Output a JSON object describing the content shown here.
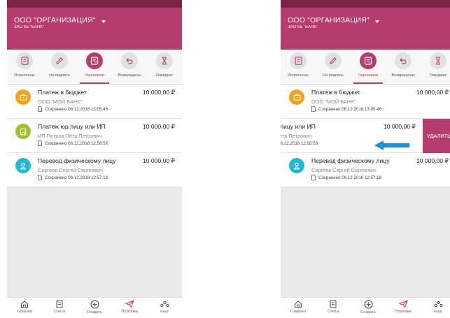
{
  "org": {
    "name": "ООО \"ОРГАНИЗАЦИЯ\"",
    "bank": "ЗАО КБ \"БАНК\""
  },
  "tabs": [
    {
      "label": "Исполнены",
      "icon": "document-icon"
    },
    {
      "label": "На подпись",
      "icon": "pen-icon"
    },
    {
      "label": "Черновики",
      "icon": "draft-icon",
      "active": true
    },
    {
      "label": "Возвращены",
      "icon": "return-arrow-icon"
    },
    {
      "label": "Ожидают",
      "icon": "hourglass-icon"
    }
  ],
  "payments": [
    {
      "title": "Платеж в бюджет",
      "amount": "10 000,00 ₽",
      "subtitle": "ООО \"МОЙ БАНК\"",
      "saved": "Сохранено 06.12.2018 13:05:46",
      "icon": "briefcase-icon",
      "color": "#f5a11a"
    },
    {
      "title": "Платеж юр.лицу или ИП",
      "amount": "10 000,00 ₽",
      "subtitle": "ИП Петров Пётр Петрович",
      "saved": "Сохранено 06.12.2018 12:58:56",
      "icon": "building-icon",
      "color": "#9ebf2a"
    },
    {
      "title": "Перевод физическому лицу",
      "amount": "10 000,00 ₽",
      "subtitle": "Сергеев Сергей Сергеевич",
      "saved": "Сохранено 06.12.2018 12:57:18",
      "icon": "person-icon",
      "color": "#22b8d4"
    }
  ],
  "delete_label": "УДАЛИТЬ",
  "nav": [
    {
      "label": "Главная",
      "icon": "home-icon"
    },
    {
      "label": "Счета",
      "icon": "accounts-icon"
    },
    {
      "label": "Создать",
      "icon": "plus-circle-icon"
    },
    {
      "label": "Платежи",
      "icon": "paper-plane-icon",
      "active": true
    },
    {
      "label": "Ещё",
      "icon": "more-icon"
    }
  ],
  "colors": {
    "accent": "#b63b6e",
    "statusbar": "#7d2346",
    "arrow": "#1e8fd6"
  }
}
